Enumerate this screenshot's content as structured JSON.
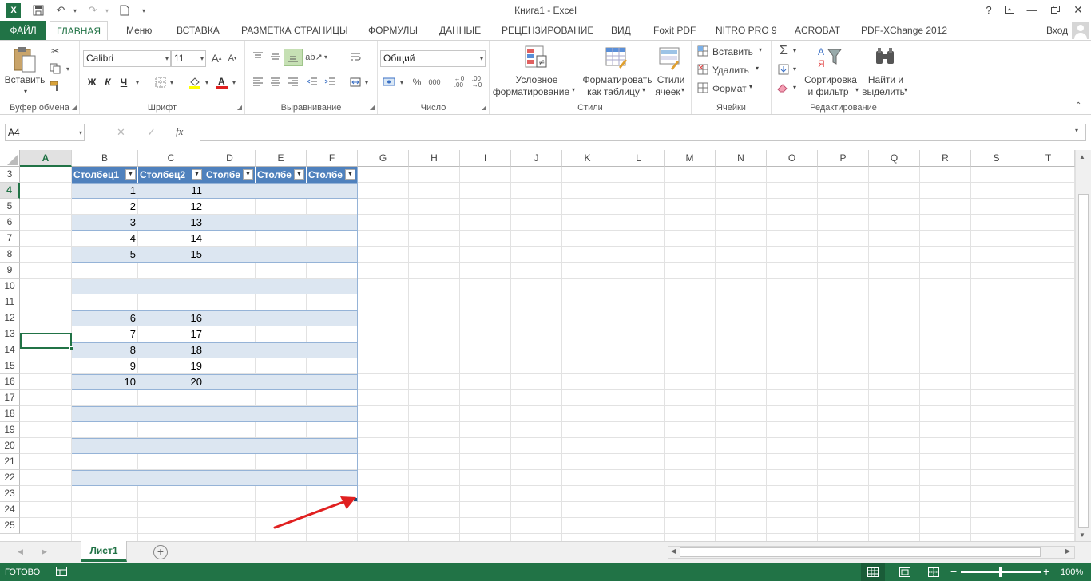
{
  "window": {
    "title": "Книга1 - Excel"
  },
  "tabs": [
    {
      "label": "ФАЙЛ"
    },
    {
      "label": "ГЛАВНАЯ"
    },
    {
      "label": "Меню"
    },
    {
      "label": "ВСТАВКА"
    },
    {
      "label": "РАЗМЕТКА СТРАНИЦЫ"
    },
    {
      "label": "ФОРМУЛЫ"
    },
    {
      "label": "ДАННЫЕ"
    },
    {
      "label": "РЕЦЕНЗИРОВАНИЕ"
    },
    {
      "label": "ВИД"
    },
    {
      "label": "Foxit PDF"
    },
    {
      "label": "NITRO PRO 9"
    },
    {
      "label": "ACROBAT"
    },
    {
      "label": "PDF-XChange 2012"
    }
  ],
  "account": {
    "login": "Вход"
  },
  "ribbon": {
    "clipboard": {
      "paste": "Вставить",
      "label": "Буфер обмена"
    },
    "font": {
      "name": "Calibri",
      "size": "11",
      "bold": "Ж",
      "italic": "К",
      "underline": "Ч",
      "grow": "A",
      "shrink": "A",
      "label": "Шрифт"
    },
    "alignment": {
      "label": "Выравнивание"
    },
    "number": {
      "format": "Общий",
      "label": "Число",
      "percent": "%",
      "thousands": "000"
    },
    "styles": {
      "conditional_1": "Условное",
      "conditional_2": "форматирование",
      "table_1": "Форматировать",
      "table_2": "как таблицу",
      "cell_1": "Стили",
      "cell_2": "ячеек",
      "label": "Стили"
    },
    "cells": {
      "insert": "Вставить",
      "delete": "Удалить",
      "format": "Формат",
      "label": "Ячейки"
    },
    "editing": {
      "sort_1": "Сортировка",
      "sort_2": "и фильтр",
      "find_1": "Найти и",
      "find_2": "выделить",
      "label": "Редактирование"
    }
  },
  "formula_bar": {
    "name_box": "A4",
    "cancel": "✕",
    "enter": "✓",
    "fx": "fx",
    "value": ""
  },
  "columns": [
    "A",
    "B",
    "C",
    "D",
    "E",
    "F",
    "G",
    "H",
    "I",
    "J",
    "K",
    "L",
    "M",
    "N",
    "O",
    "P",
    "Q",
    "R",
    "S",
    "T"
  ],
  "rows": [
    "3",
    "4",
    "5",
    "6",
    "7",
    "8",
    "9",
    "10",
    "11",
    "12",
    "13",
    "14",
    "15",
    "16",
    "17",
    "18",
    "19",
    "20",
    "21",
    "22",
    "23",
    "24",
    "25"
  ],
  "table": {
    "headers": [
      "Столбец1",
      "Столбец2",
      "Столбе",
      "Столбе",
      "Столбе"
    ],
    "rows": [
      [
        "1",
        "11"
      ],
      [
        "2",
        "12"
      ],
      [
        "3",
        "13"
      ],
      [
        "4",
        "14"
      ],
      [
        "5",
        "15"
      ],
      [
        "",
        ""
      ],
      [
        "",
        ""
      ],
      [
        "",
        ""
      ],
      [
        "6",
        "16"
      ],
      [
        "7",
        "17"
      ],
      [
        "8",
        "18"
      ],
      [
        "9",
        "19"
      ],
      [
        "10",
        "20"
      ],
      [
        "",
        ""
      ],
      [
        "",
        ""
      ],
      [
        "",
        ""
      ],
      [
        "",
        ""
      ],
      [
        "",
        ""
      ],
      [
        "",
        ""
      ],
      [
        "",
        ""
      ]
    ]
  },
  "sheets": [
    {
      "label": "Лист1"
    }
  ],
  "status": {
    "text": "ГОТОВО",
    "zoom": "100%"
  },
  "colors": {
    "accent": "#217346",
    "table_header": "#4f81bd",
    "band": "#dce6f1",
    "arrow": "#e02020"
  }
}
